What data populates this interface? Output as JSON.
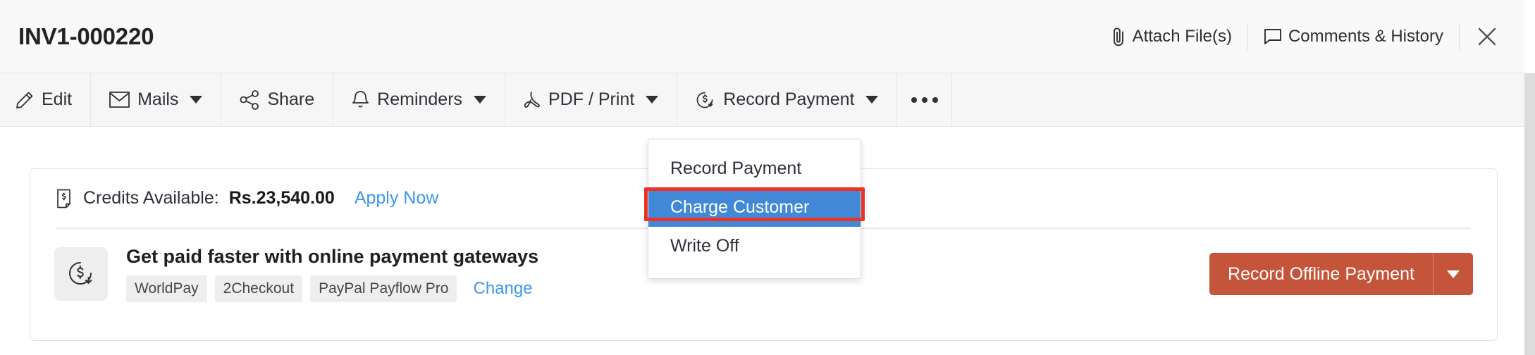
{
  "header": {
    "title": "INV1-000220",
    "actions": [
      {
        "label": "Attach File(s)",
        "icon": "paperclip-icon"
      },
      {
        "label": "Comments & History",
        "icon": "comment-icon"
      }
    ],
    "close_icon": "close-icon"
  },
  "toolbar": {
    "buttons": [
      {
        "label": "Edit",
        "icon": "pencil-icon",
        "caret": false
      },
      {
        "label": "Mails",
        "icon": "envelope-icon",
        "caret": true
      },
      {
        "label": "Share",
        "icon": "share-nodes-icon",
        "caret": false
      },
      {
        "label": "Reminders",
        "icon": "bell-icon",
        "caret": true
      },
      {
        "label": "PDF / Print",
        "icon": "pdf-icon",
        "caret": true
      },
      {
        "label": "Record Payment",
        "icon": "record-payment-icon",
        "caret": true
      }
    ],
    "more_label": "more-options"
  },
  "dropdown": {
    "items": [
      {
        "label": "Record Payment",
        "selected": false
      },
      {
        "label": "Charge Customer",
        "selected": true
      },
      {
        "label": "Write Off",
        "selected": false
      }
    ],
    "selected_bg": "#4189d6",
    "highlight_color": "#ee3124"
  },
  "card": {
    "credits": {
      "icon": "credit-note-icon",
      "label": "Credits Available:",
      "amount": "Rs.23,540.00",
      "apply_link": "Apply Now"
    },
    "gateway": {
      "icon": "payment-gateway-icon",
      "title": "Get paid faster with online payment gateways",
      "tags": [
        "WorldPay",
        "2Checkout",
        "PayPal Payflow Pro"
      ],
      "change_link": "Change"
    },
    "offline_button": {
      "label": "Record Offline Payment",
      "color": "#c4553a",
      "caret_icon": "chevron-down-icon"
    }
  }
}
